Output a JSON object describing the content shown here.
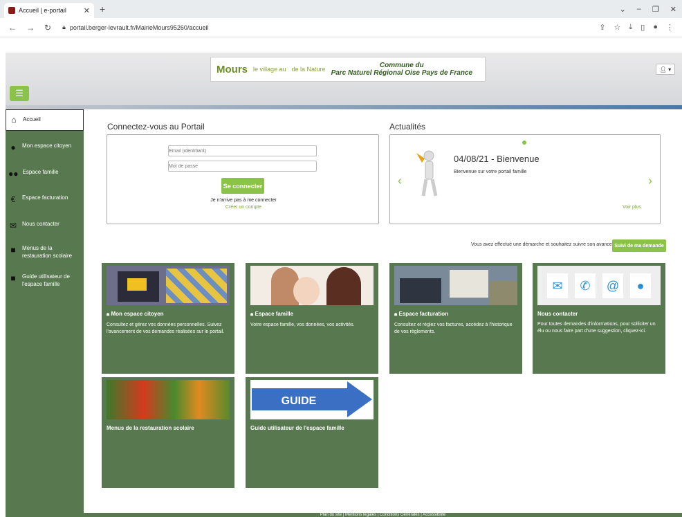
{
  "browser": {
    "tab_title": "Accueil | e-portail",
    "url": "portail.berger-levrault.fr/MairieMours95260/accueil"
  },
  "banner": {
    "brand": "Mours",
    "slogan_left": "le village au",
    "slogan_right": "de la Nature",
    "commune_line1": "Commune du",
    "commune_line2": "Parc Naturel Régional Oise Pays de France"
  },
  "sidebar": {
    "items": [
      {
        "label": "Accueil",
        "icon": "home-icon"
      },
      {
        "label": "Mon espace citoyen",
        "icon": "user-icon"
      },
      {
        "label": "Espace famille",
        "icon": "family-icon"
      },
      {
        "label": "Espace facturation",
        "icon": "euro-icon"
      },
      {
        "label": "Nous contacter",
        "icon": "envelope-icon"
      },
      {
        "label": "Menus de la restauration scolaire",
        "icon": "document-icon"
      },
      {
        "label": "Guide utilisateur de l'espace famille",
        "icon": "document-icon"
      }
    ]
  },
  "login": {
    "heading": "Connectez-vous au Portail",
    "email_placeholder": "Email (identifiant)",
    "password_placeholder": "Mot de passe",
    "submit": "Se connecter",
    "trouble": "Je n'arrive pas à me connecter",
    "create": "Créer un compte"
  },
  "news": {
    "heading": "Actualités",
    "title": "04/08/21 - Bienvenue",
    "body": "Bienvenue sur votre portail famille",
    "more": "Voir plus"
  },
  "tracking": {
    "text": "Vous avez effectué une démarche et souhaitez suivre son avancement",
    "button": "Suivi de ma demande"
  },
  "cards": [
    {
      "title": "Mon espace citoyen",
      "desc": "Consultez et gérez vos données personnelles. Suivez l'avancement de vos demandes réalisées sur le portail."
    },
    {
      "title": "Espace famille",
      "desc": "Votre espace famille, vos données, vos activités."
    },
    {
      "title": "Espace facturation",
      "desc": "Consultez et réglez vos factures, accédez à l'historique de vos règlements."
    },
    {
      "title": "Nous contacter",
      "desc": "Pour toutes demandes d'informations, pour solliciter un élu ou nous faire part d'une suggestion, cliquez-ici."
    },
    {
      "title": "Menus de la restauration scolaire",
      "desc": ""
    },
    {
      "title": "Guide utilisateur de l'espace famille",
      "desc": ""
    }
  ],
  "guide_image_text": "GUIDE",
  "footer": "Plan du site | Mentions légales | Conditions Générales | Accessibilité",
  "colors": {
    "green_dark": "#58784f",
    "green_light": "#8bc34a"
  }
}
